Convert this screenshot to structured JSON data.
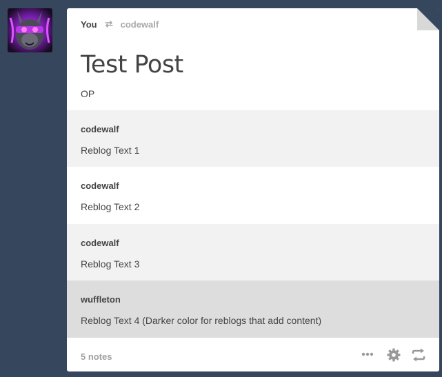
{
  "post": {
    "header": {
      "user": "You",
      "reblogged_from": "codewalf"
    },
    "title": "Test Post",
    "op_text": "OP",
    "reblogs": [
      {
        "author": "codewalf",
        "text": "Reblog Text 1"
      },
      {
        "author": "codewalf",
        "text": "Reblog Text 2"
      },
      {
        "author": "codewalf",
        "text": "Reblog Text 3"
      },
      {
        "author": "wuffleton",
        "text": "Reblog Text 4 (Darker color for reblogs that add content)"
      }
    ],
    "footer": {
      "notes": "5 notes"
    }
  },
  "colors": {
    "dashboard_background": "#36465d",
    "post_background": "#ffffff",
    "reblog_alt_background": "#f2f2f2",
    "reblog_content_background": "#dddddd",
    "text": "#444444",
    "muted_text": "#a8a8a8"
  },
  "icons": {
    "header": "reblog-icon",
    "footer": [
      "more-icon",
      "gear-icon",
      "reblog-icon"
    ]
  }
}
